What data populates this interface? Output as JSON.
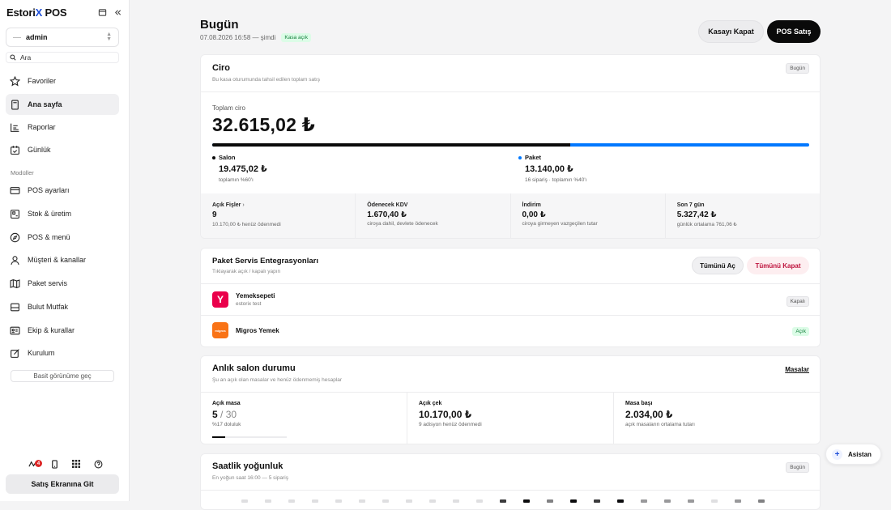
{
  "sidebar": {
    "brand_a": "Estori",
    "brand_x": "X",
    "brand_b": " POS",
    "user": "admin",
    "search_placeholder": "Ara",
    "section_modules": "Modüller",
    "simple_view": "Basit görünüme geç",
    "notif_count": "4",
    "go_sales": "Satış Ekranına Git",
    "nav": [
      {
        "label": "Favoriler",
        "icon": "star-icon"
      },
      {
        "label": "Ana sayfa",
        "icon": "calculator-icon",
        "active": true
      },
      {
        "label": "Raporlar",
        "icon": "chart-icon"
      },
      {
        "label": "Günlük",
        "icon": "calendar-check-icon"
      },
      {
        "label": "POS ayarları",
        "icon": "card-icon"
      },
      {
        "label": "Stok & üretim",
        "icon": "stock-icon"
      },
      {
        "label": "POS & menü",
        "icon": "compass-icon"
      },
      {
        "label": "Müşteri & kanallar",
        "icon": "user-icon"
      },
      {
        "label": "Paket servis",
        "icon": "map-icon"
      },
      {
        "label": "Bulut Mutfak",
        "icon": "cloud-kitchen-icon"
      },
      {
        "label": "Ekip & kurallar",
        "icon": "id-card-icon"
      },
      {
        "label": "Kurulum",
        "icon": "edit-icon"
      }
    ]
  },
  "header": {
    "title": "Bugün",
    "subtitle": "07.08.2026 16:58 — şimdi",
    "status": "Kasa açık",
    "btn_close": "Kasayı Kapat",
    "btn_pos": "POS Satış"
  },
  "ciro": {
    "title": "Ciro",
    "subtitle": "Bu kasa oturumunda tahsil edilen toplam satış",
    "tag": "Bugün",
    "total_label": "Toplam ciro",
    "total": "32.615,02 ₺",
    "salon": {
      "label": "Salon",
      "value": "19.475,02 ₺",
      "note": "toplamın %60'ı",
      "share": 0.6
    },
    "paket": {
      "label": "Paket",
      "value": "13.140,00 ₺",
      "note": "16 sipariş · toplamın %40'ı"
    },
    "colors": {
      "salon": "#0a0a0a",
      "paket": "#0078ff"
    },
    "stats": [
      {
        "label": "Açık Fişler",
        "chev": "›",
        "value": "9",
        "desc": "10.170,00 ₺ henüz ödenmedi"
      },
      {
        "label": "Ödenecek KDV",
        "value": "1.670,40 ₺",
        "desc": "ciroya dahil, devlete ödenecek"
      },
      {
        "label": "İndirim",
        "value": "0,00 ₺",
        "desc": "ciroya girmeyen vazgeçilen tutar"
      },
      {
        "label": "Son 7 gün",
        "value": "5.327,42 ₺",
        "desc": "günlük ortalama 761,06 ₺"
      }
    ]
  },
  "paket_servis": {
    "title": "Paket Servis Entegrasyonları",
    "subtitle": "Tıklayarak açık / kapalı yapın",
    "open_all": "Tümünü Aç",
    "close_all": "Tümünü Kapat",
    "items": [
      {
        "name": "Yemeksepeti",
        "desc": "estorix test",
        "status": "Kapalı",
        "logo": "Y",
        "color": "#ea004b"
      },
      {
        "name": "Migros Yemek",
        "desc": "",
        "status": "Açık",
        "logo": "migros",
        "color": "#f97316"
      }
    ]
  },
  "salon": {
    "title": "Anlık salon durumu",
    "subtitle": "Şu an açık olan masalar ve henüz ödenmemiş hesaplar",
    "link": "Masalar",
    "cols": [
      {
        "label": "Açık masa",
        "value": "5",
        "max": "/ 30",
        "desc": "%17 doluluk",
        "fill": 0.17
      },
      {
        "label": "Açık çek",
        "value": "10.170,00 ₺",
        "desc": "9 adisyon henüz ödenmedi"
      },
      {
        "label": "Masa başı",
        "value": "2.034,00 ₺",
        "desc": "açık masaların ortalama tutarı"
      }
    ]
  },
  "hourly": {
    "title": "Saatlik yoğunluk",
    "subtitle": "En yoğun saat 16:00 — 5 sipariş",
    "tag": "Bugün",
    "levels": [
      0.05,
      0.05,
      0.05,
      0.05,
      0.05,
      0.05,
      0.05,
      0.05,
      0.05,
      0.05,
      0.05,
      0.75,
      0.95,
      0.45,
      0.95,
      0.75,
      0.95,
      0.35,
      0.35,
      0.35,
      0.05,
      0.35,
      0.45
    ]
  },
  "assistant": "Asistan"
}
